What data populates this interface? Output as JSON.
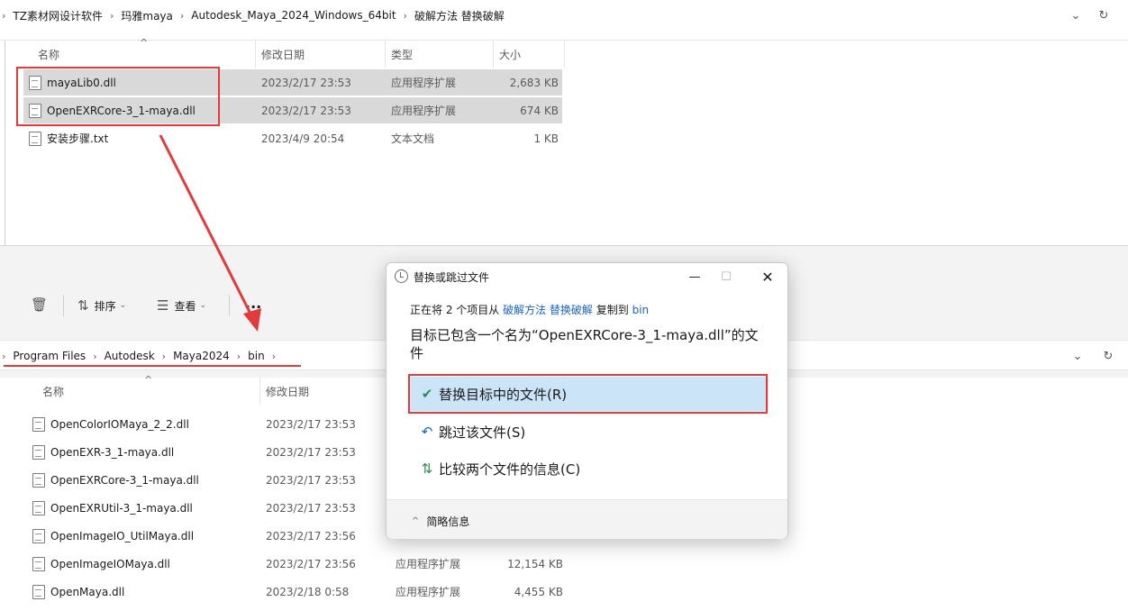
{
  "top_window": {
    "breadcrumbs": [
      "TZ素材网设计软件",
      "玛雅maya",
      "Autodesk_Maya_2024_Windows_64bit",
      "破解方法 替换破解"
    ],
    "columns": {
      "name": "名称",
      "modified": "修改日期",
      "type": "类型",
      "size": "大小"
    },
    "files": [
      {
        "name": "mayaLib0.dll",
        "modified": "2023/2/17 23:53",
        "type": "应用程序扩展",
        "size": "2,683 KB",
        "selected": true
      },
      {
        "name": "OpenEXRCore-3_1-maya.dll",
        "modified": "2023/2/17 23:53",
        "type": "应用程序扩展",
        "size": "674 KB",
        "selected": true
      },
      {
        "name": "安装步骤.txt",
        "modified": "2023/4/9 20:54",
        "type": "文本文档",
        "size": "1 KB",
        "selected": false
      }
    ]
  },
  "bottom_window": {
    "toolbar": {
      "sort": "排序",
      "view": "查看",
      "more": "..."
    },
    "breadcrumbs": [
      "Program Files",
      "Autodesk",
      "Maya2024",
      "bin"
    ],
    "columns": {
      "name": "名称",
      "modified": "修改日期"
    },
    "files": [
      {
        "name": "OpenColorIOMaya_2_2.dll",
        "modified": "2023/2/17 23:53",
        "type": "",
        "size": ""
      },
      {
        "name": "OpenEXR-3_1-maya.dll",
        "modified": "2023/2/17 23:53",
        "type": "",
        "size": ""
      },
      {
        "name": "OpenEXRCore-3_1-maya.dll",
        "modified": "2023/2/17 23:53",
        "type": "",
        "size": ""
      },
      {
        "name": "OpenEXRUtil-3_1-maya.dll",
        "modified": "2023/2/17 23:53",
        "type": "",
        "size": ""
      },
      {
        "name": "OpenImageIO_UtilMaya.dll",
        "modified": "2023/2/17 23:56",
        "type": "",
        "size": ""
      },
      {
        "name": "OpenImageIOMaya.dll",
        "modified": "2023/2/17 23:56",
        "type": "应用程序扩展",
        "size": "12,154 KB"
      },
      {
        "name": "OpenMaya.dll",
        "modified": "2023/2/18 0:58",
        "type": "应用程序扩展",
        "size": "4,455 KB"
      }
    ]
  },
  "dialog": {
    "title": "替换或跳过文件",
    "line_prefix": "正在将 2 个项目从",
    "line_source": "破解方法 替换破解",
    "line_middle": "复制到",
    "line_dest": "bin",
    "heading": "目标已包含一个名为“OpenEXRCore-3_1-maya.dll”的文件",
    "options": {
      "replace": "替换目标中的文件(R)",
      "skip": "跳过该文件(S)",
      "compare": "比较两个文件的信息(C)"
    },
    "more_info": "简略信息"
  },
  "colors": {
    "annotation_red": "#e23b3b",
    "selected_row": "#d9d9d9",
    "active_option": "#cce4f7",
    "link_blue": "#1a63c7"
  }
}
